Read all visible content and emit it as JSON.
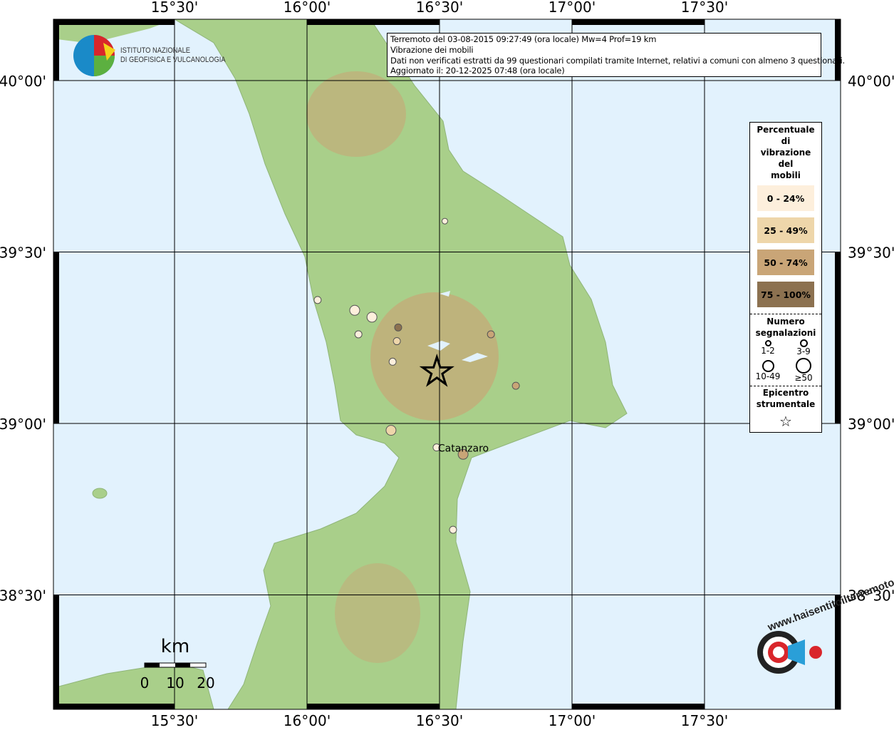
{
  "title_box": {
    "line1": "Terremoto del 03-08-2015 09:27:49 (ora locale) Mw=4 Prof=19 km",
    "line2": "Vibrazione dei mobili",
    "line3": "Dati non verificati estratti da 99 questionari compilati tramite Internet, relativi a comuni con almeno 3 questionari.",
    "line4": "Aggiornato il: 20-12-2025 07:48 (ora locale)"
  },
  "logo": {
    "line1": "ISTITUTO NAZIONALE",
    "line2": "DI GEOFISICA E VULCANOLOGIA"
  },
  "axes": {
    "lon_ticks": [
      "15°30'",
      "16°00'",
      "16°30'",
      "17°00'",
      "17°30'"
    ],
    "lat_ticks": [
      "40°00'",
      "39°30'",
      "39°00'",
      "38°30'"
    ]
  },
  "legend": {
    "title": [
      "Percentuale",
      "di",
      "vibrazione",
      "del",
      "mobili"
    ],
    "classes": [
      {
        "label": "0 - 24%",
        "color": "#fdefdc"
      },
      {
        "label": "25 - 49%",
        "color": "#eed6aa"
      },
      {
        "label": "50 - 74%",
        "color": "#c9a577"
      },
      {
        "label": "75 - 100%",
        "color": "#8c7150"
      }
    ],
    "count_title": [
      "Numero",
      "segnalazioni"
    ],
    "counts": [
      "1-2",
      "3-9",
      "10-49",
      "≥50"
    ],
    "epicenter_title": [
      "Epicentro",
      "strumentale"
    ]
  },
  "scale": {
    "unit": "km",
    "labels": [
      "0",
      "10",
      "20"
    ]
  },
  "places": [
    {
      "name": "Catanzaro",
      "lon": 16.59,
      "lat": 38.91
    }
  ],
  "sea_color": "#e2f2fd",
  "land_color": "#a9cf8a",
  "epicenter": {
    "lon": 16.49,
    "lat": 39.15
  },
  "observations": [
    {
      "lon": 16.52,
      "lat": 39.59,
      "class": 0,
      "count": "1-2"
    },
    {
      "lon": 16.04,
      "lat": 39.36,
      "class": 0,
      "count": "3-9"
    },
    {
      "lon": 16.18,
      "lat": 39.33,
      "class": 0,
      "count": "10-49"
    },
    {
      "lon": 16.245,
      "lat": 39.31,
      "class": 0,
      "count": "10-49"
    },
    {
      "lon": 16.344,
      "lat": 39.28,
      "class": 3,
      "count": "3-9"
    },
    {
      "lon": 16.194,
      "lat": 39.26,
      "class": 0,
      "count": "3-9"
    },
    {
      "lon": 16.339,
      "lat": 39.24,
      "class": 1,
      "count": "3-9"
    },
    {
      "lon": 16.323,
      "lat": 39.18,
      "class": 0,
      "count": "3-9"
    },
    {
      "lon": 16.694,
      "lat": 39.26,
      "class": 2,
      "count": "3-9"
    },
    {
      "lon": 16.788,
      "lat": 39.11,
      "class": 2,
      "count": "3-9"
    },
    {
      "lon": 16.317,
      "lat": 38.98,
      "class": 1,
      "count": "10-49"
    },
    {
      "lon": 16.489,
      "lat": 38.93,
      "class": 0,
      "count": "3-9"
    },
    {
      "lon": 16.589,
      "lat": 38.91,
      "class": 2,
      "count": "10-49"
    },
    {
      "lon": 16.551,
      "lat": 38.69,
      "class": 0,
      "count": "3-9"
    }
  ],
  "watermark": "www.haisentitoilterremoto.it"
}
